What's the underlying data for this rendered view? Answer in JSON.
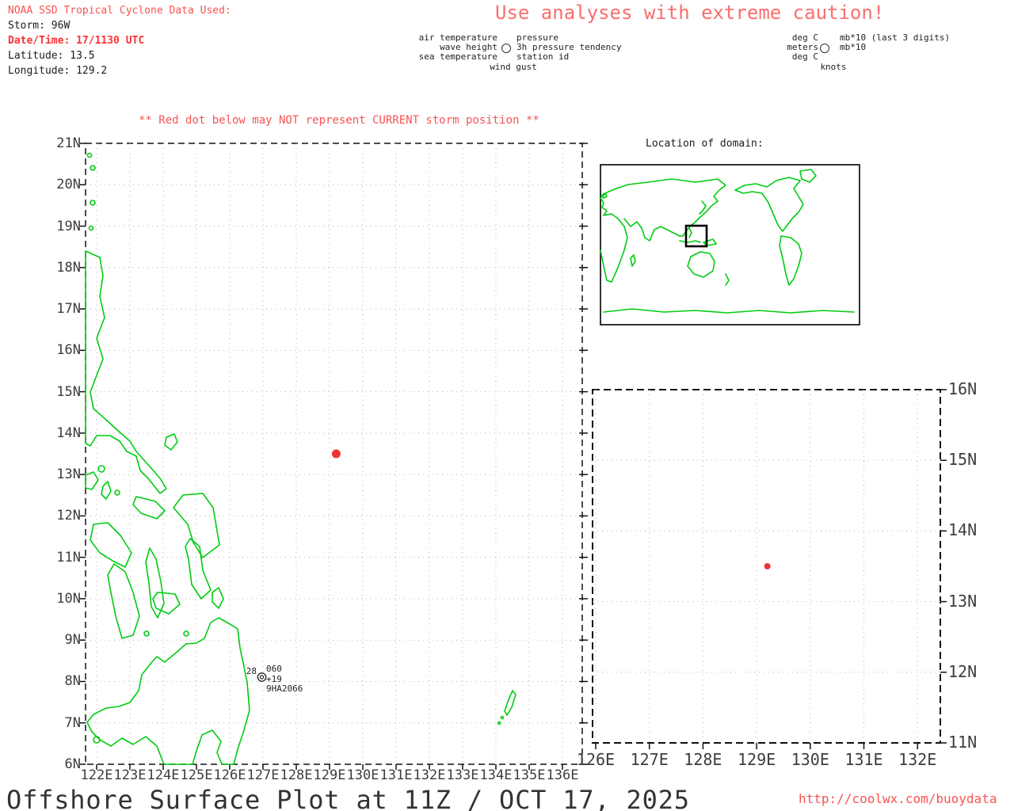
{
  "header": {
    "line1": "NOAA SSD Tropical Cyclone Data Used:",
    "line2": "Storm: 96W",
    "line3": "Date/Time: 17/1130 UTC",
    "line4": "Latitude: 13.5",
    "line5": "Longitude: 129.2"
  },
  "caution": "Use analyses with extreme caution!",
  "station_legend": {
    "left": [
      "air temperature",
      "wave height",
      "sea temperature"
    ],
    "right": [
      "pressure",
      "3h pressure tendency",
      "station id"
    ],
    "bottom": "wind gust"
  },
  "units_legend": {
    "left": [
      "deg C",
      "meters",
      "deg C"
    ],
    "right": [
      "mb*10 (last 3 digits)",
      "mb*10"
    ],
    "bottom": "knots"
  },
  "warning": "** Red dot below may NOT represent CURRENT storm position **",
  "main_map": {
    "lat_labels": [
      "21N",
      "20N",
      "19N",
      "18N",
      "17N",
      "16N",
      "15N",
      "14N",
      "13N",
      "12N",
      "11N",
      "10N",
      "9N",
      "8N",
      "7N",
      "6N"
    ],
    "lon_labels": [
      "122E",
      "123E",
      "124E",
      "125E",
      "126E",
      "127E",
      "128E",
      "129E",
      "130E",
      "131E",
      "132E",
      "133E",
      "134E",
      "135E",
      "136E"
    ]
  },
  "station_plot": {
    "air_temp": "28",
    "pressure": "060",
    "tendency": "+19",
    "id": "9HA2066"
  },
  "storm": {
    "lon": 129.2,
    "lat": 13.5
  },
  "domain_inset": {
    "title": "Location of domain:"
  },
  "zoom_inset": {
    "lat_labels": [
      "16N",
      "15N",
      "14N",
      "13N",
      "12N",
      "11N"
    ],
    "lon_labels": [
      "126E",
      "127E",
      "128E",
      "129E",
      "130E",
      "131E",
      "132E"
    ]
  },
  "footer": {
    "title": "Offshore Surface Plot at 11Z / OCT 17, 2025",
    "url": "http://coolwx.com/buoydata"
  },
  "colors": {
    "red_text": "#fa5252",
    "red_bold": "#fa3434",
    "red_light": "#fa6e6e",
    "green": "#00cc11",
    "dot_red": "#ee3434",
    "grid": "#b4b4b4",
    "frame": "#111111",
    "label": "#3d3d3d"
  }
}
